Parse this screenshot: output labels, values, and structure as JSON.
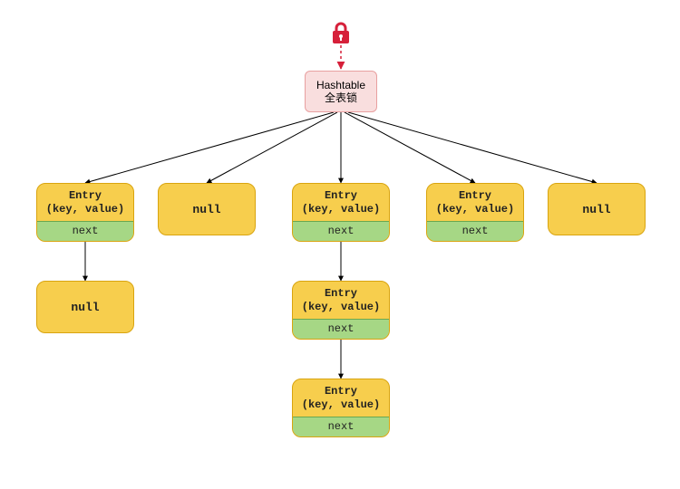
{
  "lock": {
    "name": "lock-icon"
  },
  "root": {
    "line1": "Hashtable",
    "line2": "全表锁"
  },
  "entry_label_line1": "Entry",
  "entry_label_line2": "(key, value)",
  "next_label": "next",
  "null_label": "null",
  "buckets": [
    {
      "type": "entry",
      "chain": [
        "entry",
        "null"
      ]
    },
    {
      "type": "null"
    },
    {
      "type": "entry",
      "chain": [
        "entry",
        "entry",
        "entry"
      ]
    },
    {
      "type": "entry",
      "chain": [
        "entry"
      ]
    },
    {
      "type": "null"
    }
  ],
  "chart_data": {
    "type": "diagram",
    "title": "Hashtable 全表锁",
    "description": "Hashtable with global lock; 5 buckets containing Entry(key,value)->next chains or null",
    "buckets": [
      {
        "index": 0,
        "head": "Entry",
        "next": "null"
      },
      {
        "index": 1,
        "head": "null"
      },
      {
        "index": 2,
        "head": "Entry",
        "next": "Entry",
        "next2": "Entry"
      },
      {
        "index": 3,
        "head": "Entry"
      },
      {
        "index": 4,
        "head": "null"
      }
    ]
  }
}
